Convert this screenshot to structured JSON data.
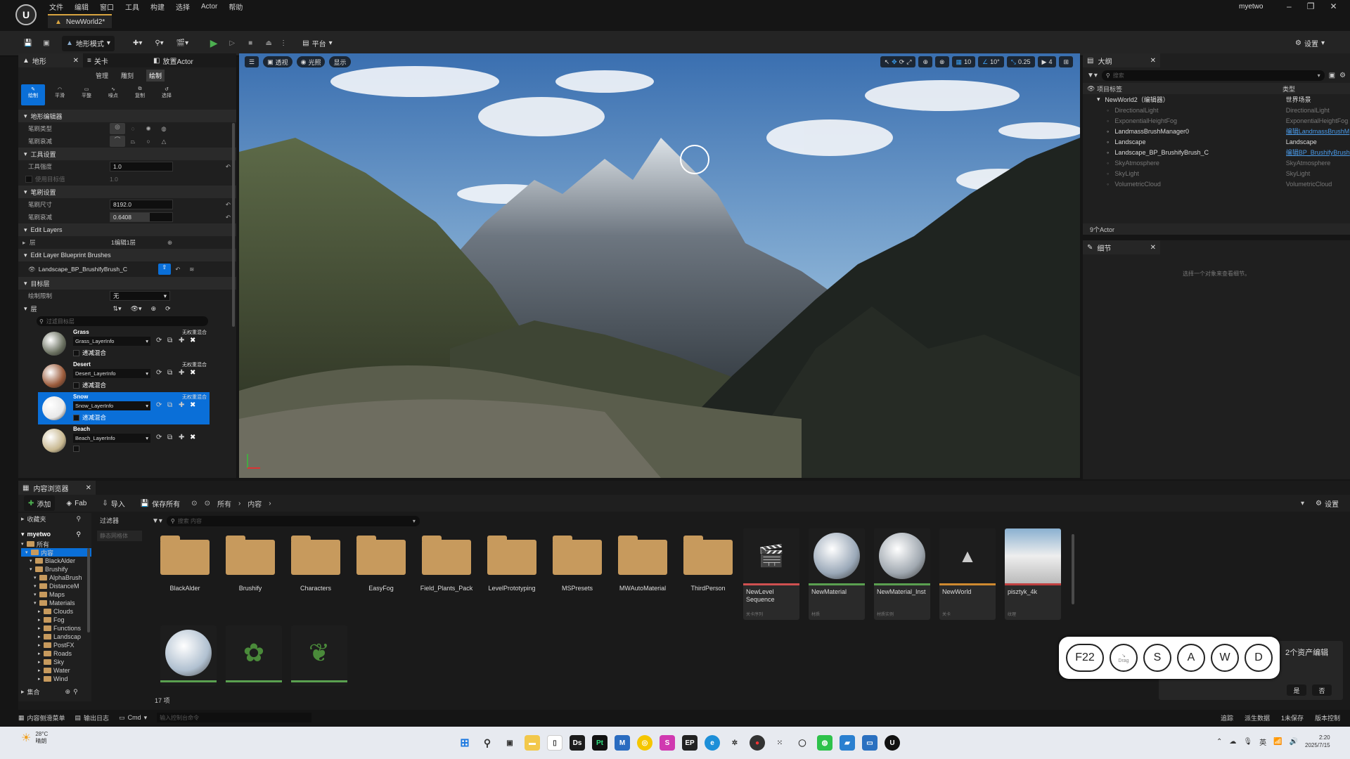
{
  "title_bar": {
    "menu": [
      "文件",
      "编辑",
      "窗口",
      "工具",
      "构建",
      "选择",
      "Actor",
      "帮助"
    ],
    "doc_tab": "NewWorld2*",
    "user": "myetwo"
  },
  "toolbar": {
    "mode": "地形模式",
    "platform": "平台",
    "settings": "设置"
  },
  "left_panel": {
    "tabs": [
      "地形",
      "关卡",
      "放置Actor"
    ],
    "subtabs": [
      "管理",
      "雕刻",
      "绘制"
    ],
    "tools": [
      "绘制",
      "平滑",
      "平整",
      "噪点",
      "复制",
      "选择"
    ],
    "sections": {
      "brush_editor": "地形编辑器",
      "brush_type": "笔刷类型",
      "brush_falloff": "笔刷衰减",
      "tool_settings": "工具设置",
      "tool_strength": "工具强度",
      "tool_strength_val": "1.0",
      "use_target_value": "使用目标值",
      "use_target_val": "1.0",
      "brush_settings": "笔刷设置",
      "brush_size": "笔刷尺寸",
      "brush_size_val": "8192.0",
      "brush_falloff2": "笔刷衰减",
      "brush_falloff_val": "0.6408",
      "edit_layers": "Edit Layers",
      "layer": "层",
      "layer_val": "1编辑1层",
      "edit_layer_bp": "Edit Layer Blueprint Brushes",
      "bp_brush": "Landscape_BP_BrushifyBrush_C",
      "target_layer": "目标层",
      "paint_restriction": "绘制限制",
      "paint_restriction_val": "无",
      "layers": "层",
      "filter_placeholder": "过滤目标层"
    },
    "layers": [
      {
        "name": "Grass",
        "info": "Grass_LayerInfo",
        "blend": "无权重混合",
        "check": "递减混合"
      },
      {
        "name": "Desert",
        "info": "Desert_LayerInfo",
        "blend": "无权重混合",
        "check": "递减混合"
      },
      {
        "name": "Snow",
        "info": "Snow_LayerInfo",
        "blend": "无权重混合",
        "check": "递减混合"
      },
      {
        "name": "Beach",
        "info": "Beach_LayerInfo",
        "blend": "",
        "check": ""
      }
    ]
  },
  "viewport": {
    "buttons": [
      "透视",
      "光照",
      "显示"
    ],
    "grid": "10",
    "angle": "10°",
    "scale": "0.25",
    "cam": "4"
  },
  "outliner": {
    "tab": "大纲",
    "search_placeholder": "搜索",
    "col_label": "项目标签",
    "col_type": "类型",
    "rows": [
      {
        "label": "NewWorld2（编辑器）",
        "type": "世界场景",
        "indent": 1,
        "dim": false,
        "link": false
      },
      {
        "label": "DirectionalLight",
        "type": "DirectionalLight",
        "indent": 2,
        "dim": true,
        "link": false
      },
      {
        "label": "ExponentialHeightFog",
        "type": "ExponentialHeightFog",
        "indent": 2,
        "dim": true,
        "link": false
      },
      {
        "label": "LandmassBrushManager0",
        "type": "编辑LandmassBrushM",
        "indent": 2,
        "dim": false,
        "link": true
      },
      {
        "label": "Landscape",
        "type": "Landscape",
        "indent": 2,
        "dim": false,
        "link": false
      },
      {
        "label": "Landscape_BP_BrushifyBrush_C",
        "type": "编辑BP_BrushifyBrush",
        "indent": 2,
        "dim": false,
        "link": true
      },
      {
        "label": "SkyAtmosphere",
        "type": "SkyAtmosphere",
        "indent": 2,
        "dim": true,
        "link": false
      },
      {
        "label": "SkyLight",
        "type": "SkyLight",
        "indent": 2,
        "dim": true,
        "link": false
      },
      {
        "label": "VolumetricCloud",
        "type": "VolumetricCloud",
        "indent": 2,
        "dim": true,
        "link": false
      }
    ],
    "count": "9个Actor"
  },
  "details": {
    "tab": "细节",
    "hint": "选择一个对象来查看细节。"
  },
  "content_browser": {
    "tab": "内容浏览器",
    "add": "添加",
    "fab": "Fab",
    "import": "导入",
    "save_all": "保存所有",
    "breadcrumb": [
      "所有",
      "内容"
    ],
    "settings": "设置",
    "favorites": "收藏夹",
    "project": "myetwo",
    "filters": "过滤器",
    "filter_hint": "静态网格体",
    "search_placeholder": "搜索 内容",
    "tree": [
      {
        "label": "所有",
        "lvl": 0
      },
      {
        "label": "内容",
        "lvl": 1
      },
      {
        "label": "BlackAlder",
        "lvl": 2
      },
      {
        "label": "Brushify",
        "lvl": 2
      },
      {
        "label": "AlphaBrush",
        "lvl": 3
      },
      {
        "label": "DistanceM",
        "lvl": 3
      },
      {
        "label": "Maps",
        "lvl": 3
      },
      {
        "label": "Materials",
        "lvl": 3
      },
      {
        "label": "Clouds",
        "lvl": 4
      },
      {
        "label": "Fog",
        "lvl": 4
      },
      {
        "label": "Functions",
        "lvl": 4
      },
      {
        "label": "Landscap",
        "lvl": 4
      },
      {
        "label": "PostFX",
        "lvl": 4
      },
      {
        "label": "Roads",
        "lvl": 4
      },
      {
        "label": "Sky",
        "lvl": 4
      },
      {
        "label": "Water",
        "lvl": 4
      },
      {
        "label": "Wind",
        "lvl": 4
      }
    ],
    "collections": "集合",
    "folders": [
      "BlackAlder",
      "Brushify",
      "Characters",
      "EasyFog",
      "Field_Plants_Pack",
      "LevelPrototyping",
      "MSPresets",
      "MWAutoMaterial",
      "ThirdPerson"
    ],
    "assets": [
      {
        "name": "NewLevel Sequence",
        "type": "关卡序列",
        "bar": "#d05050"
      },
      {
        "name": "NewMaterial",
        "type": "材质",
        "bar": "#5aa050"
      },
      {
        "name": "NewMaterial_Inst",
        "type": "材质实例",
        "bar": "#5aa050"
      },
      {
        "name": "NewWorld",
        "type": "关卡",
        "bar": "#d08a30"
      },
      {
        "name": "pisztyk_4k",
        "type": "纹理",
        "bar": "#c04040"
      }
    ],
    "count": "17 项"
  },
  "popup": {
    "text": "2个资产编辑",
    "yes": "是",
    "no": "否"
  },
  "keys": [
    "F22",
    "Drag",
    "S",
    "A",
    "W",
    "D"
  ],
  "status_bar": {
    "items": [
      "内容侧滑菜单",
      "输出日志",
      "Cmd"
    ],
    "cmd_placeholder": "输入控制台命令",
    "right": [
      "追踪",
      "派生数据",
      "1未保存",
      "版本控制"
    ]
  },
  "taskbar": {
    "weather": "28°C",
    "weather_sub": "晴朗",
    "time": "2:20",
    "date": "2025/7/15",
    "lang": "英"
  }
}
